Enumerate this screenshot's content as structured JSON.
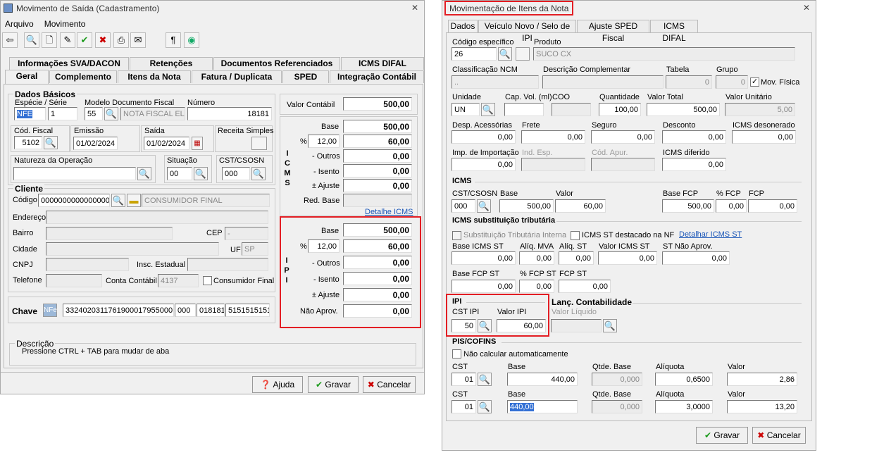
{
  "left": {
    "title": "Movimento de Saída (Cadastramento)",
    "menu": [
      "Arquivo",
      "Movimento"
    ],
    "tabs_row1": [
      "Informações SVA/DACON",
      "Retenções",
      "Documentos Referenciados",
      "ICMS DIFAL"
    ],
    "tabs_row2": [
      "Geral",
      "Complemento",
      "Itens da Nota",
      "Fatura / Duplicata",
      "SPED",
      "Integração Contábil"
    ],
    "dados_basicos": {
      "title": "Dados Básicos",
      "especie_serie_label": "Espécie  /  Série",
      "especie": "NFE",
      "serie": "1",
      "modelo_label": "Modelo Documento Fiscal",
      "modelo": "55",
      "modelo_desc": "NOTA FISCAL EL",
      "numero_label": "Número",
      "numero": "18181",
      "cod_fiscal_label": "Cód. Fiscal",
      "cod_fiscal": "5102",
      "emissao_label": "Emissão",
      "emissao": "01/02/2024",
      "saida_label": "Saída",
      "saida": "01/02/2024",
      "receita_label": "Receita Simples",
      "natureza_label": "Natureza da Operação",
      "situacao_label": "Situação",
      "situacao": "00",
      "cst_label": "CST/CSOSN",
      "cst": "000"
    },
    "cliente": {
      "title": "Cliente",
      "codigo_label": "Código",
      "codigo": "0000000000000000",
      "nome": "CONSUMIDOR FINAL",
      "endereco_label": "Endereço",
      "bairro_label": "Bairro",
      "cep_label": "CEP",
      "cep": "-",
      "cidade_label": "Cidade",
      "uf_label": "UF",
      "uf": "SP",
      "cnpj_label": "CNPJ",
      "insc_label": "Insc. Estadual",
      "telefone_label": "Telefone",
      "conta_label": "Conta Contábil",
      "conta": "4137",
      "consumidor_label": "Consumidor Final"
    },
    "chave": {
      "label": "Chave",
      "nfe_icon": "NFe",
      "c1": "33240203117619000179550001",
      "c2": "000",
      "c3": "018181",
      "c4": "5151515151"
    },
    "descricao": {
      "label": "Descrição",
      "text": "Pressione CTRL + TAB para  mudar de aba"
    },
    "valor_contabil_label": "Valor Contábil",
    "valor_contabil": "500,00",
    "icms": {
      "vert": "I C M S",
      "base_label": "Base",
      "base": "500,00",
      "pct_label": "%",
      "pct": "12,00",
      "valor": "60,00",
      "outros_label": "- Outros",
      "outros": "0,00",
      "isento_label": "- Isento",
      "isento": "0,00",
      "ajuste_label": "± Ajuste",
      "ajuste": "0,00",
      "redbase_label": "Red. Base",
      "detalhe": "Detalhe ICMS"
    },
    "ipi": {
      "vert": "I P I",
      "base_label": "Base",
      "base": "500,00",
      "pct_label": "%",
      "pct": "12,00",
      "valor": "60,00",
      "outros_label": "- Outros",
      "outros": "0,00",
      "isento_label": "- Isento",
      "isento": "0,00",
      "ajuste_label": "± Ajuste",
      "ajuste": "0,00",
      "naoaprov_label": "Não Aprov.",
      "naoaprov": "0,00"
    },
    "buttons": {
      "ajuda": "Ajuda",
      "gravar": "Gravar",
      "cancelar": "Cancelar"
    }
  },
  "right": {
    "title": "Movimentação de Itens da Nota",
    "tabs": [
      "Dados",
      "Veículo Novo / Selo de IPI",
      "Ajuste SPED Fiscal",
      "ICMS DIFAL"
    ],
    "cod_label": "Código específico",
    "cod": "26",
    "produto_label": "Produto",
    "produto": "SUCO CX",
    "ncm_label": "Classificação NCM",
    "ncm": "..",
    "desc_label": "Descrição Complementar",
    "tabela_label": "Tabela",
    "tabela": "0",
    "grupo_label": "Grupo",
    "grupo": "0",
    "movfis_label": "Mov. Física",
    "unidade_label": "Unidade",
    "unidade": "UN",
    "capvol_label": "Cap. Vol. (ml)",
    "coo_label": "COO",
    "qtd_label": "Quantidade",
    "qtd": "100,00",
    "vtotal_label": "Valor Total",
    "vtotal": "500,00",
    "vunit_label": "Valor Unitário",
    "vunit": "5,00",
    "desp_label": "Desp. Acessórias",
    "desp": "0,00",
    "frete_label": "Frete",
    "frete": "0,00",
    "seguro_label": "Seguro",
    "seguro": "0,00",
    "desconto_label": "Desconto",
    "desconto": "0,00",
    "icmsdes_label": "ICMS desonerado",
    "icmsdes": "0,00",
    "imp_label": "Imp. de Importação",
    "imp": "0,00",
    "indesp_label": "Ind. Esp.",
    "codapur_label": "Cód. Apur.",
    "icmsdif_label": "ICMS diferido",
    "icmsdif": "0,00",
    "icms_title": "ICMS",
    "icms_cst_label": "CST/CSOSN",
    "icms_cst": "000",
    "icms_base_label": "Base",
    "icms_base": "500,00",
    "icms_valor_label": "Valor",
    "icms_valor": "60,00",
    "basefcp_label": "Base FCP",
    "basefcp": "500,00",
    "pfcp_label": "% FCP",
    "pfcp": "0,00",
    "fcp_label": "FCP",
    "fcp": "0,00",
    "st_title": "ICMS substituição tributária",
    "st_interna_label": "Substituição Tributária Interna",
    "st_destacado_label": "ICMS ST destacado na NF",
    "st_detalhar": "Detalhar ICMS ST",
    "basest_label": "Base ICMS ST",
    "basest": "0,00",
    "mva_label": "Alíq. MVA",
    "mva": "0,00",
    "aliqst_label": "Alíq. ST",
    "aliqst": "0,00",
    "vst_label": "Valor ICMS ST",
    "vst": "0,00",
    "stnao_label": "ST Não Aprov.",
    "stnao": "0,00",
    "basefcpst_label": "Base FCP ST",
    "basefcpst": "0,00",
    "pfcpst_label": "% FCP ST",
    "pfcpst": "0,00",
    "fcpst_label": "FCP ST",
    "fcpst": "0,00",
    "ipi_title": "IPI",
    "ipi_cst_label": "CST IPI",
    "ipi_cst": "50",
    "ipi_valor_label": "Valor IPI",
    "ipi_valor": "60,00",
    "lanc_title": "Lanç. Contabilidade",
    "vliq_label": "Valor Líquido",
    "pis_title": "PIS/COFINS",
    "naocalc_label": "Não calcular automaticamente",
    "cst_label": "CST",
    "base_label": "Base",
    "qtdbase_label": "Qtde. Base",
    "aliq_label": "Alíquota",
    "valor_label": "Valor",
    "pis": {
      "cst": "01",
      "base": "440,00",
      "qtd": "0,000",
      "aliq": "0,6500",
      "valor": "2,86"
    },
    "cofins": {
      "cst": "01",
      "base": "440,00",
      "qtd": "0,000",
      "aliq": "3,0000",
      "valor": "13,20"
    },
    "buttons": {
      "gravar": "Gravar",
      "cancelar": "Cancelar"
    }
  },
  "colors": {
    "highlight": "#e31e24",
    "link": "#1a56b8",
    "selection": "#3370d4"
  }
}
